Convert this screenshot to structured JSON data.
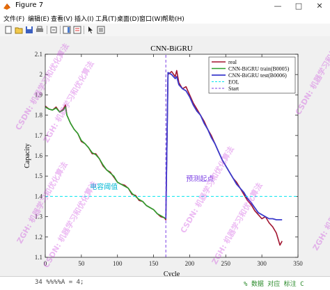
{
  "window": {
    "title": "Figure 7",
    "minimize": "—",
    "maximize": "□",
    "close": "✕"
  },
  "menu": [
    "文件(F)",
    "编辑(E)",
    "查看(V)",
    "插入(I)",
    "工具(T)",
    "桌面(D)",
    "窗口(W)",
    "帮助(H)"
  ],
  "toolbar": {
    "icons": [
      "new-figure-icon",
      "open-icon",
      "save-icon",
      "print-icon",
      "link-icon",
      "insert-colorbar-icon",
      "insert-legend-icon",
      "pointer-icon",
      "property-editor-icon"
    ]
  },
  "colors": {
    "real": "#a2142f",
    "train": "#2ca02c",
    "test": "#3a3acb",
    "eol": "#00e5ee",
    "start": "#7b3fe4",
    "annot_eol": "#00b8d4",
    "annot_start": "#7b3fe4"
  },
  "bottom_code": {
    "left": "34      %%%%A = 4;",
    "right": "% 数据 对应 标注 C"
  },
  "watermark": {
    "text": "ZGH: 机器学习和优化算法",
    "text2": "CSDN: 机器学习和优化算法"
  },
  "chart_data": {
    "type": "line",
    "title": "CNN-BiGRU",
    "xlabel": "Cycle",
    "ylabel": "Capacity",
    "xlim": [
      0,
      350
    ],
    "ylim": [
      1.1,
      2.1
    ],
    "xticks": [
      0,
      50,
      100,
      150,
      200,
      250,
      300,
      350
    ],
    "yticks": [
      1.1,
      1.2,
      1.3,
      1.4,
      1.5,
      1.6,
      1.7,
      1.8,
      1.9,
      2.0,
      2.1
    ],
    "ytick_labels": [
      "1.1",
      "1.2",
      "1.3",
      "1.4",
      "1.5",
      "1.6",
      "1.7",
      "1.8",
      "1.9",
      "2",
      "2.1"
    ],
    "grid": false,
    "legend": "top-right",
    "series": [
      {
        "name": "real",
        "style": "solid",
        "x": [
          0,
          5,
          10,
          15,
          20,
          25,
          28,
          30,
          35,
          40,
          45,
          50,
          55,
          60,
          65,
          70,
          75,
          80,
          85,
          90,
          95,
          100,
          105,
          110,
          115,
          120,
          125,
          130,
          135,
          140,
          145,
          150,
          155,
          160,
          165,
          167,
          170,
          175,
          180,
          182,
          185,
          190,
          195,
          200,
          205,
          210,
          215,
          220,
          225,
          230,
          235,
          240,
          245,
          250,
          255,
          260,
          265,
          270,
          275,
          280,
          285,
          290,
          295,
          300,
          305,
          310,
          315,
          320,
          325,
          328
        ],
        "y": [
          1.845,
          1.83,
          1.825,
          1.84,
          1.815,
          1.83,
          1.85,
          1.8,
          1.76,
          1.73,
          1.71,
          1.67,
          1.66,
          1.64,
          1.61,
          1.61,
          1.585,
          1.55,
          1.53,
          1.52,
          1.495,
          1.47,
          1.46,
          1.455,
          1.44,
          1.41,
          1.405,
          1.38,
          1.375,
          1.355,
          1.345,
          1.335,
          1.315,
          1.3,
          1.295,
          1.285,
          2.0,
          2.015,
          1.99,
          2.02,
          1.96,
          1.93,
          1.94,
          1.9,
          1.86,
          1.83,
          1.8,
          1.77,
          1.73,
          1.7,
          1.66,
          1.62,
          1.58,
          1.55,
          1.52,
          1.49,
          1.47,
          1.44,
          1.41,
          1.38,
          1.36,
          1.33,
          1.31,
          1.29,
          1.3,
          1.27,
          1.25,
          1.22,
          1.16,
          1.18
        ]
      },
      {
        "name": "CNN-BiGRU train(B0005)",
        "style": "solid",
        "x": [
          0,
          5,
          10,
          15,
          20,
          25,
          28,
          30,
          35,
          40,
          45,
          50,
          55,
          60,
          65,
          70,
          75,
          80,
          85,
          90,
          95,
          100,
          105,
          110,
          115,
          120,
          125,
          130,
          135,
          140,
          145,
          150,
          155,
          160,
          165,
          167
        ],
        "y": [
          1.84,
          1.83,
          1.825,
          1.835,
          1.815,
          1.825,
          1.84,
          1.8,
          1.76,
          1.73,
          1.71,
          1.675,
          1.66,
          1.64,
          1.615,
          1.605,
          1.585,
          1.555,
          1.53,
          1.515,
          1.5,
          1.47,
          1.46,
          1.45,
          1.44,
          1.415,
          1.4,
          1.385,
          1.375,
          1.355,
          1.345,
          1.335,
          1.315,
          1.305,
          1.295,
          1.29
        ]
      },
      {
        "name": "CNN-BiGRU test(B0006)",
        "style": "solid",
        "x": [
          167,
          170,
          175,
          180,
          182,
          185,
          190,
          195,
          200,
          205,
          210,
          215,
          220,
          225,
          230,
          235,
          240,
          245,
          250,
          255,
          260,
          265,
          270,
          275,
          280,
          285,
          290,
          295,
          300,
          305,
          310,
          315,
          320,
          325,
          328
        ],
        "y": [
          1.29,
          2.01,
          2.0,
          1.98,
          1.99,
          1.95,
          1.93,
          1.92,
          1.89,
          1.85,
          1.82,
          1.8,
          1.76,
          1.73,
          1.69,
          1.66,
          1.62,
          1.58,
          1.55,
          1.52,
          1.49,
          1.46,
          1.44,
          1.42,
          1.39,
          1.37,
          1.345,
          1.32,
          1.31,
          1.3,
          1.29,
          1.29,
          1.285,
          1.285,
          1.285
        ]
      },
      {
        "name": "EOL",
        "style": "dashed",
        "x": [
          0,
          350
        ],
        "y": [
          1.4,
          1.4
        ]
      },
      {
        "name": "Start",
        "style": "dashed-vertical",
        "x": [
          167,
          167
        ],
        "y": [
          1.1,
          2.1
        ]
      }
    ],
    "annotations": [
      {
        "text": "电容阈值",
        "x": 62,
        "y": 1.435,
        "color": "#00b8d4"
      },
      {
        "text": "预测起点",
        "x": 195,
        "y": 1.475,
        "color": "#7b3fe4"
      }
    ]
  }
}
